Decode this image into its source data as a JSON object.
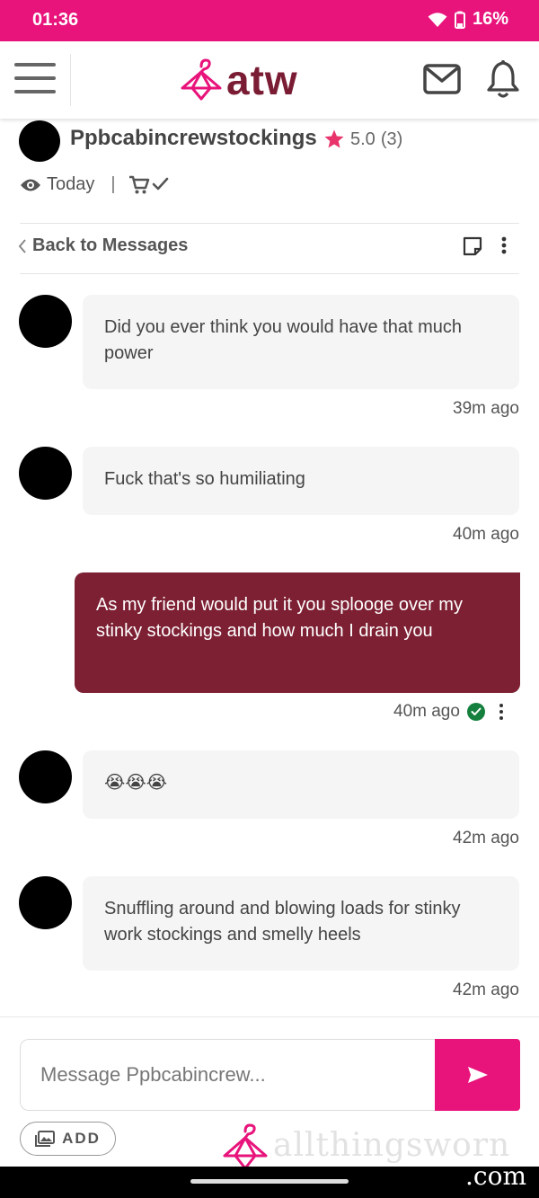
{
  "status_bar": {
    "time": "01:36",
    "battery": "16%"
  },
  "header": {
    "logo_text": "atw"
  },
  "seller": {
    "name": "Ppbcabincrewstockings",
    "rating": "5.0",
    "rating_count": "(3)",
    "last_seen": "Today"
  },
  "thread": {
    "back_label": "Back to Messages"
  },
  "messages": [
    {
      "text": "Did you ever think you would have that much power",
      "time": "39m ago",
      "mine": false
    },
    {
      "text": "Fuck that's so humiliating",
      "time": "40m ago",
      "mine": false
    },
    {
      "text": "As my friend would put it you splooge over my stinky stockings and how much I drain you",
      "time": "40m ago",
      "mine": true
    },
    {
      "text": "😭😭😭",
      "time": "42m ago",
      "mine": false
    },
    {
      "text": "Snuffling around and blowing loads for stinky work stockings and smelly heels",
      "time": "42m ago",
      "mine": false
    }
  ],
  "composer": {
    "placeholder": "Message Ppbcabincrew...",
    "add_label": "ADD"
  },
  "watermark": {
    "text": "allthingsworn",
    "suffix": ".com"
  },
  "colors": {
    "brand_pink": "#e8137b",
    "brand_wine": "#7a1d34",
    "sent_bubble": "#7d2033",
    "star": "#e8336b",
    "read_check": "#15803d"
  }
}
